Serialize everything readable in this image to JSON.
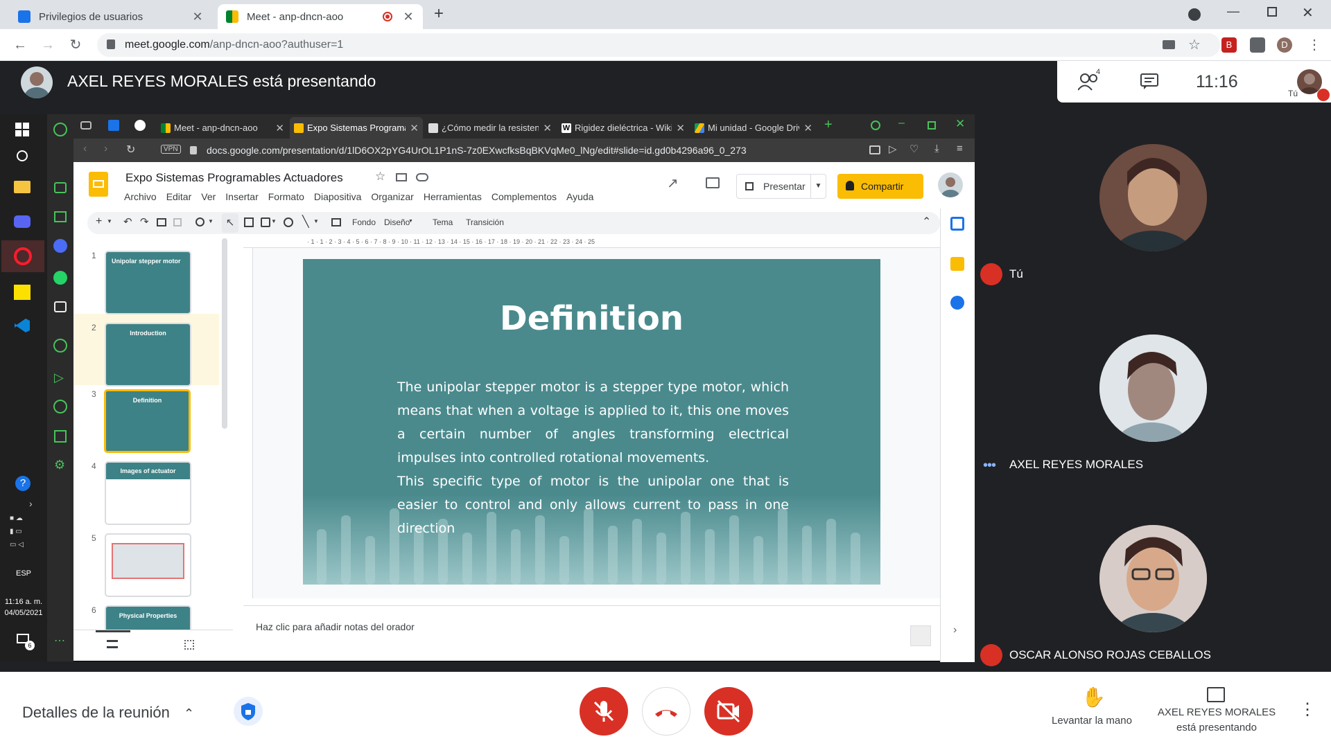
{
  "browser": {
    "tabs": [
      {
        "title": "Privilegios de usuarios",
        "active": false
      },
      {
        "title": "Meet - anp-dncn-aoo",
        "active": true,
        "recording": true
      }
    ],
    "new_tab": "+",
    "url_host": "meet.google.com",
    "url_path": "/anp-dncn-aoo?authuser=1",
    "profile_initial": "D"
  },
  "meet": {
    "presenter_banner": "AXEL REYES MORALES está presentando",
    "participant_count": "4",
    "clock": "11:16",
    "self_label": "Tú",
    "participants": [
      {
        "name": "Tú",
        "muted": true
      },
      {
        "name": "AXEL REYES MORALES",
        "muted": false
      },
      {
        "name": "OSCAR ALONSO ROJAS CEBALLOS",
        "muted": true
      }
    ],
    "meeting_details": "Detalles de la reunión",
    "raise_hand": "Levantar la mano",
    "presenting_line1": "AXEL REYES MORALES",
    "presenting_line2": "está presentando",
    "colors": {
      "danger": "#d93025",
      "dark_bg": "#202124"
    }
  },
  "shared_screen": {
    "windows": {
      "clock_time": "11:16 a. m.",
      "clock_date": "04/05/2021",
      "lang": "ESP",
      "notifications": "6"
    },
    "opera": {
      "tabs": [
        {
          "title": "Meet - anp-dncn-aoo",
          "active": false
        },
        {
          "title": "Expo Sistemas Programa",
          "active": true
        },
        {
          "title": "¿Cómo medir la resistenc",
          "active": false
        },
        {
          "title": "Rigidez dieléctrica - Wiki",
          "active": false
        },
        {
          "title": "Mi unidad - Google Drive",
          "active": false
        }
      ],
      "vpn": "VPN",
      "url": "docs.google.com/presentation/d/1lD6OX2pYG4UrOL1P1nS-7z0EXwcfksBqBKVqMe0_lNg/edit#slide=id.gd0b4296a96_0_273"
    },
    "slides_app": {
      "doc_title": "Expo Sistemas Programables Actuadores",
      "menu": [
        "Archivo",
        "Editar",
        "Ver",
        "Insertar",
        "Formato",
        "Diapositiva",
        "Organizar",
        "Herramientas",
        "Complementos",
        "Ayuda"
      ],
      "present": "Presentar",
      "share": "Compartir",
      "toolbar": {
        "fondo": "Fondo",
        "diseno": "Diseño",
        "tema": "Tema",
        "transicion": "Transición"
      },
      "ruler": "· 1 · 1 · 2 · 3 · 4 · 5 · 6 · 7 · 8 · 9 · 10 · 11 · 12 · 13 · 14 · 15 · 16 · 17 · 18 · 19 · 20 · 21 · 22 · 23 · 24 · 25",
      "thumbnails": [
        {
          "num": "1",
          "title": "Unipolar stepper motor"
        },
        {
          "num": "2",
          "title": "Introduction"
        },
        {
          "num": "3",
          "title": "Definition",
          "selected": true
        },
        {
          "num": "4",
          "title": "Images of actuator"
        },
        {
          "num": "5",
          "title": ""
        },
        {
          "num": "6",
          "title": "Physical Properties"
        }
      ],
      "slide": {
        "title": "Definition",
        "body_p1": "The unipolar stepper motor is a stepper type motor, which means that when a voltage is applied to it, this one moves a certain number of angles transforming electrical impulses into controlled rotational movements.",
        "body_p2": "This specific type of motor is the unipolar one that is easier to control and only allows current to pass in one direction",
        "bg_color": "#4a8a8d"
      },
      "notes_placeholder": "Haz clic para añadir notas del orador"
    }
  }
}
